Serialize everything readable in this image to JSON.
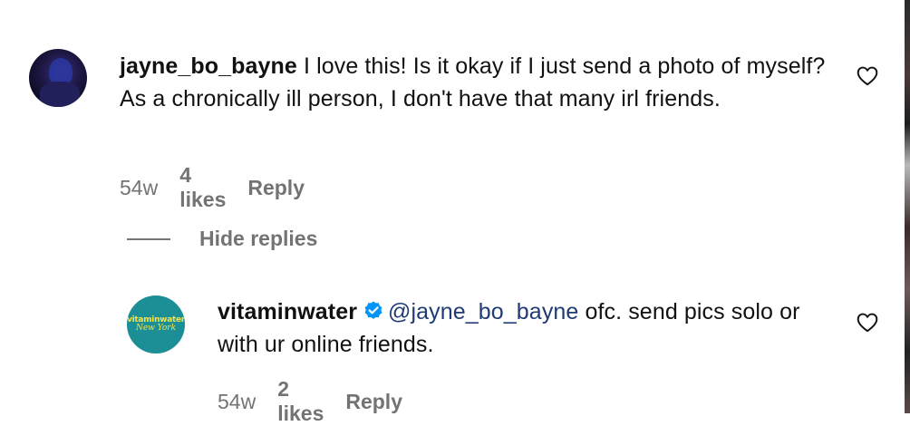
{
  "comments": [
    {
      "username": "jayne_bo_bayne",
      "text": "I love this! Is it okay if I just send a photo of myself? As a chronically ill person, I don't have that many irl friends.",
      "time": "54w",
      "likes": "4 likes",
      "reply_label": "Reply",
      "avatar_icon": "user-avatar-photo"
    }
  ],
  "hide_replies_label": "Hide replies",
  "reply": {
    "username": "vitaminwater",
    "verified": true,
    "mention": "@jayne_bo_bayne",
    "text": "ofc. send pics solo or with ur online friends.",
    "time": "54w",
    "likes": "2 likes",
    "reply_label": "Reply",
    "avatar_brand_top": "vitaminwater",
    "avatar_brand_bottom": "New York"
  },
  "colors": {
    "text": "#111111",
    "muted": "#737373",
    "mention": "#1f3b73",
    "verified": "#0095f6",
    "avatar_teal": "#1c8f96",
    "brand_yellow": "#f4e34a"
  },
  "icons": [
    "heart-icon",
    "verified-badge-icon"
  ]
}
